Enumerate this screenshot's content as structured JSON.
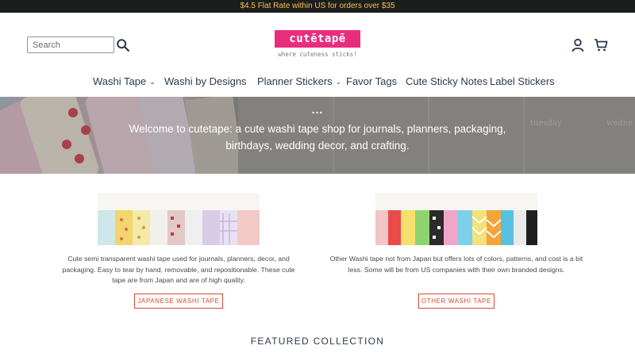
{
  "announcement": "$4.5 Flat Rate within US for orders over $35",
  "search": {
    "placeholder": "Search"
  },
  "logo": {
    "name": "cutētapē",
    "tagline": "where cuteness sticks!"
  },
  "icons": {
    "search": "search-icon",
    "account": "account-icon",
    "cart": "cart-icon"
  },
  "nav": {
    "items": [
      {
        "label": "Washi Tape",
        "has_dropdown": true
      },
      {
        "label": "Washi by Designs",
        "has_dropdown": false
      },
      {
        "label": "Planner Stickers",
        "has_dropdown": true
      },
      {
        "label": "Favor Tags",
        "has_dropdown": false
      },
      {
        "label": "Cute Sticky Notes",
        "has_dropdown": false
      },
      {
        "label": "Label Stickers",
        "has_dropdown": false
      }
    ]
  },
  "hero": {
    "dots": "...",
    "text": "Welcome to cutetape: a cute washi tape shop for journals, planners, packaging, birthdays, wedding decor, and crafting."
  },
  "collections": [
    {
      "description": "Cute semi transparent washi tape used for journals, planners, decor, and packaging. Easy to tear by hand, removable, and repositionable. These cute tape are from Japan and are of high quality.",
      "button": "JAPANESE WASHI TAPE"
    },
    {
      "description": "Other Washi tape not from Japan but offers lots of colors, patterns, and cost is a bit less. Some will be from US companies with their own branded designs.",
      "button": "OTHER WASHI TAPE"
    }
  ],
  "featured_heading": "FEATURED COLLECTION",
  "colors": {
    "announcement_bg": "#1c1d1d",
    "announcement_text": "#f6c24c",
    "brand_pink": "#e92d7d",
    "nav_text": "#2c3a4d",
    "button_accent": "#d8482f"
  }
}
